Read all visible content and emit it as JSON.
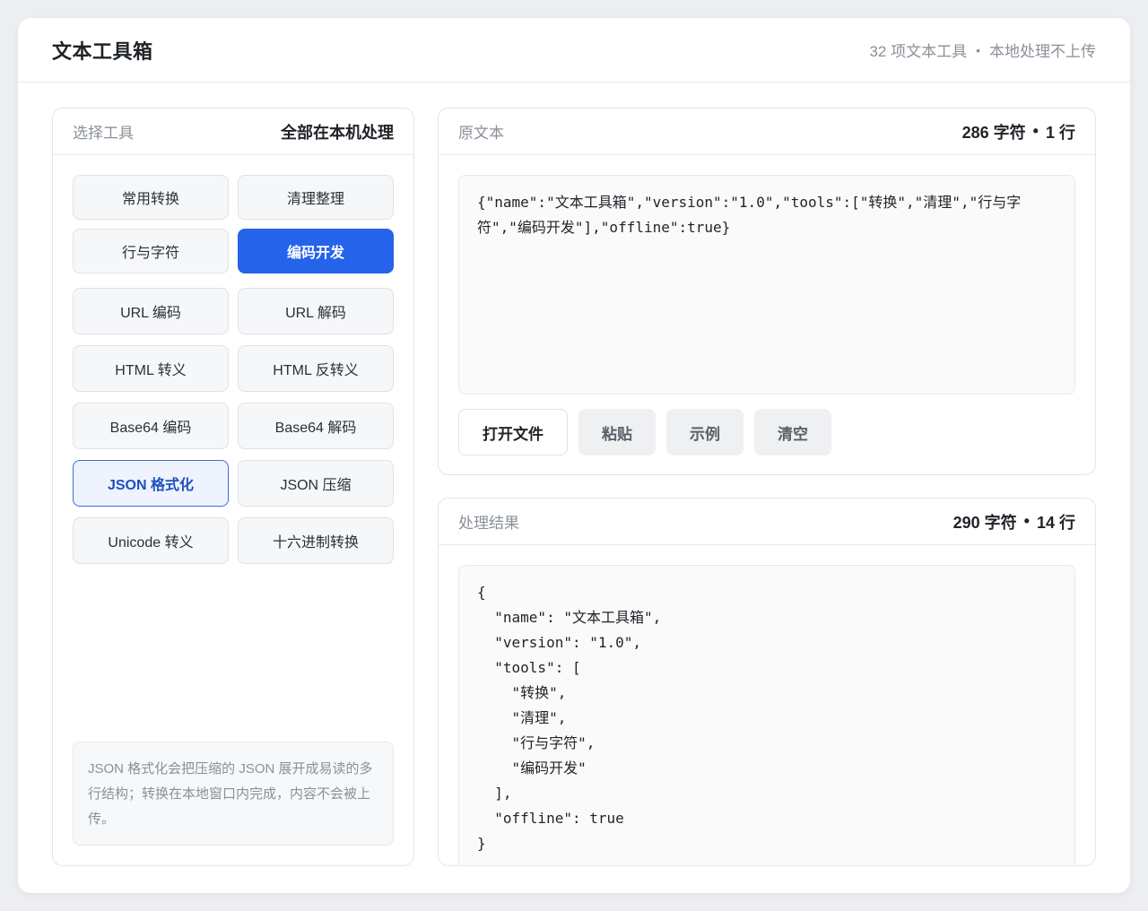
{
  "header": {
    "title": "文本工具箱",
    "tool_count": "32 项文本工具",
    "separator": "•",
    "privacy_note": "本地处理不上传"
  },
  "sidebar": {
    "label": "选择工具",
    "note": "全部在本机处理",
    "categories": [
      "常用转换",
      "清理整理",
      "行与字符",
      "编码开发"
    ],
    "active_category": "编码开发",
    "tools": [
      "URL 编码",
      "URL 解码",
      "HTML 转义",
      "HTML 反转义",
      "Base64 编码",
      "Base64 解码",
      "JSON 格式化",
      "JSON 压缩",
      "Unicode 转义",
      "十六进制转换"
    ],
    "active_tool": "JSON 格式化",
    "help_text": "JSON 格式化会把压缩的 JSON 展开成易读的多行结构；转换在本地窗口内完成，内容不会被上传。"
  },
  "source": {
    "label": "原文本",
    "chars": "286 字符",
    "separator": "•",
    "lines": "1 行",
    "text": "{\"name\":\"文本工具箱\",\"version\":\"1.0\",\"tools\":[\"转换\",\"清理\",\"行与字符\",\"编码开发\"],\"offline\":true}",
    "actions": {
      "open_file": "打开文件",
      "paste": "粘贴",
      "example": "示例",
      "clear": "清空"
    }
  },
  "result": {
    "label": "处理结果",
    "chars": "290 字符",
    "separator": "•",
    "lines": "14 行",
    "text": "{\n  \"name\": \"文本工具箱\",\n  \"version\": \"1.0\",\n  \"tools\": [\n    \"转换\",\n    \"清理\",\n    \"行与字符\",\n    \"编码开发\"\n  ],\n  \"offline\": true\n}"
  },
  "colors": {
    "accent": "#2563eb",
    "active_tool_bg": "#eef3fd",
    "active_tool_border": "#3b6fd8"
  }
}
